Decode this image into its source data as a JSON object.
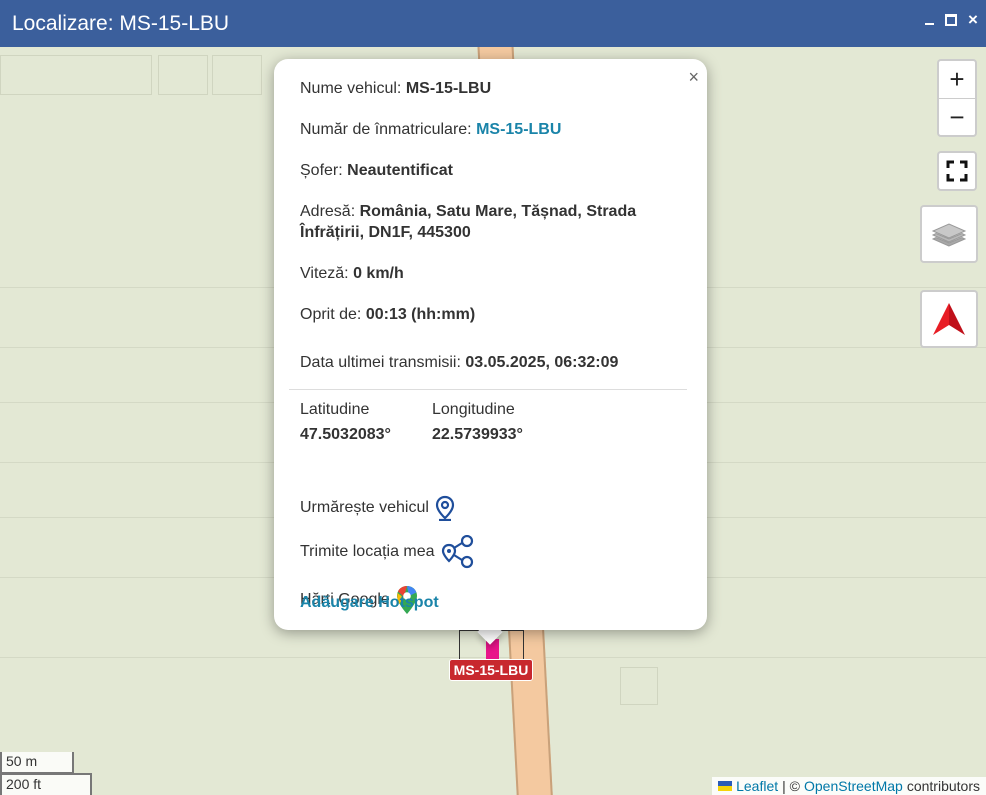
{
  "window": {
    "title": "Localizare: MS-15-LBU"
  },
  "map_controls": {
    "zoom_in": "+",
    "zoom_out": "−"
  },
  "marker": {
    "label": "MS-15-LBU"
  },
  "popup": {
    "close": "×",
    "vehicle_name": {
      "label": "Nume vehicul:",
      "value": "MS-15-LBU"
    },
    "registration": {
      "label": "Număr de înmatriculare:",
      "value": "MS-15-LBU"
    },
    "driver": {
      "label": "Șofer:",
      "value": "Neautentificat"
    },
    "address": {
      "label": "Adresă:",
      "value": "România, Satu Mare, Tășnad, Strada Înfrățirii, DN1F, 445300"
    },
    "speed": {
      "label": "Viteză:",
      "value": "0 km/h"
    },
    "stopped": {
      "label": "Oprit de:",
      "value": "00:13 (hh:mm)"
    },
    "last_transmission": {
      "label": "Data ultimei transmisii:",
      "value": "03.05.2025, 06:32:09"
    },
    "latitude": {
      "label": "Latitudine",
      "value": "47.5032083°"
    },
    "longitude": {
      "label": "Longitudine",
      "value": "22.5739933°"
    },
    "follow_vehicle": "Urmărește vehicul",
    "send_location": "Trimite locația mea",
    "google_maps": "Hărți Google",
    "add_hotspot": "Adăugare Hotspot"
  },
  "scale": {
    "metric": "50 m",
    "imperial": "200 ft"
  },
  "attribution": {
    "leaflet": "Leaflet",
    "separator": "| ©",
    "osm": "OpenStreetMap",
    "contributors": "contributors"
  },
  "colors": {
    "titlebar": "#3b5f9c",
    "link": "#1a84a9",
    "marker_label": "#c8282e",
    "marker_pin": "#e8148a"
  }
}
